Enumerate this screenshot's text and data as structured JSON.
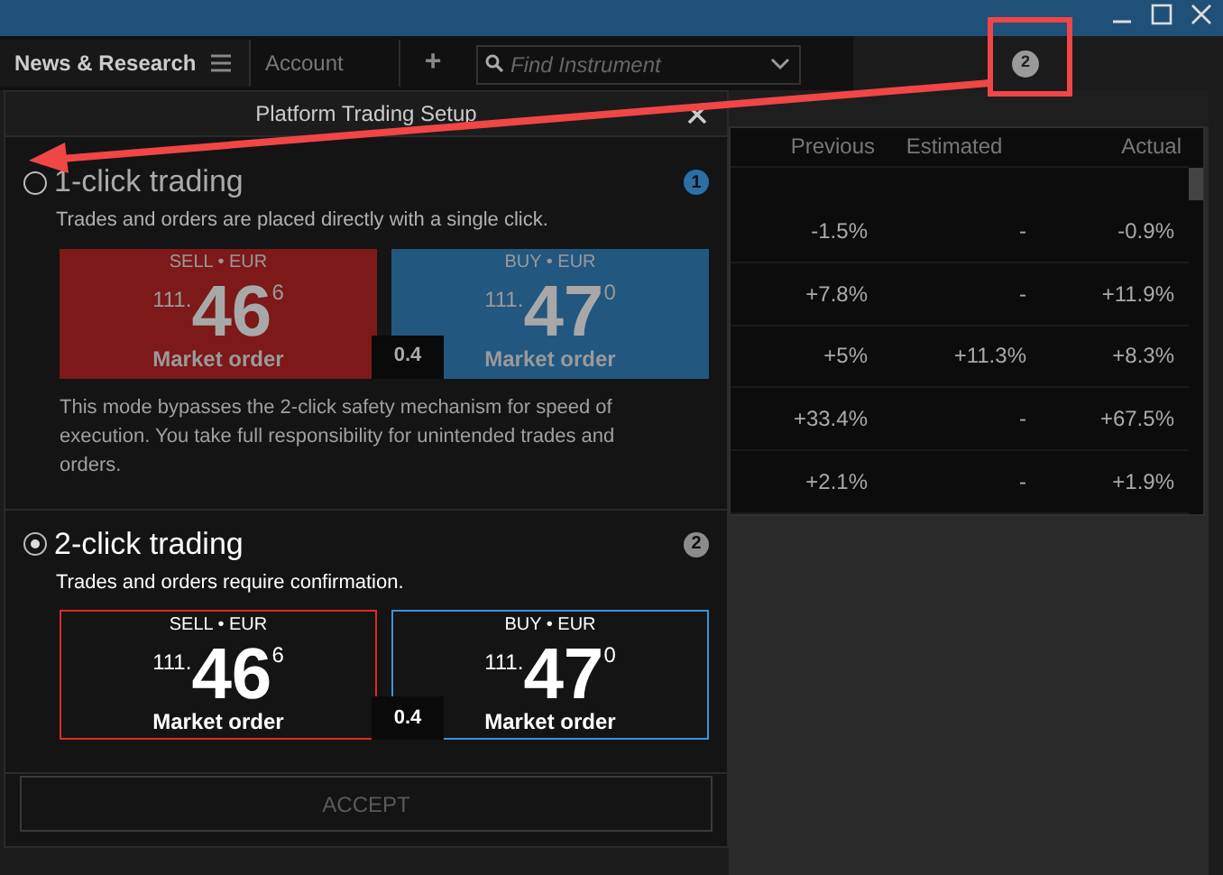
{
  "toolbar": {
    "tabs": [
      {
        "label": "News & Research",
        "selected": true
      },
      {
        "label": "Account",
        "selected": false
      }
    ],
    "add_tab": "+",
    "search": {
      "placeholder": "Find Instrument"
    },
    "notification_badge": "2"
  },
  "table": {
    "columns": [
      "Previous",
      "Estimated",
      "Actual"
    ],
    "rows": [
      [
        "-1.5%",
        "-",
        "-0.9%"
      ],
      [
        "+7.8%",
        "-",
        "+11.9%"
      ],
      [
        "+5%",
        "+11.3%",
        "+8.3%"
      ],
      [
        "+33.4%",
        "-",
        "+67.5%"
      ],
      [
        "+2.1%",
        "-",
        "+1.9%"
      ]
    ]
  },
  "dialog": {
    "title": "Platform Trading Setup",
    "options": [
      {
        "kind": "one-click",
        "selected": false,
        "title": "1-click trading",
        "step": "1",
        "color": "#2a6fa6",
        "description": "Trades and orders are placed directly with a single click.",
        "quotes": [
          {
            "kind": "sell",
            "label": "SELL • EUR",
            "prefix": "111.",
            "pips": "46",
            "fraction": "6",
            "order_type": "Market order"
          },
          {
            "kind": "buy",
            "label": "BUY • EUR",
            "prefix": "111.",
            "pips": "47",
            "fraction": "0",
            "order_type": "Market order"
          }
        ],
        "spread": "0.4",
        "note": "This mode bypasses the 2-click safety mechanism for speed of execution. You take full responsibility for unintended trades and orders."
      },
      {
        "kind": "two-click",
        "selected": true,
        "title": "2-click trading",
        "step": "2",
        "color": "#8c8c8c",
        "description": "Trades and orders require confirmation.",
        "quotes": [
          {
            "kind": "sell",
            "label": "SELL • EUR",
            "prefix": "111.",
            "pips": "46",
            "fraction": "6",
            "order_type": "Market order"
          },
          {
            "kind": "buy",
            "label": "BUY • EUR",
            "prefix": "111.",
            "pips": "47",
            "fraction": "0",
            "order_type": "Market order"
          }
        ],
        "spread": "0.4"
      }
    ],
    "accept": {
      "label": "ACCEPT",
      "disabled": true
    }
  }
}
